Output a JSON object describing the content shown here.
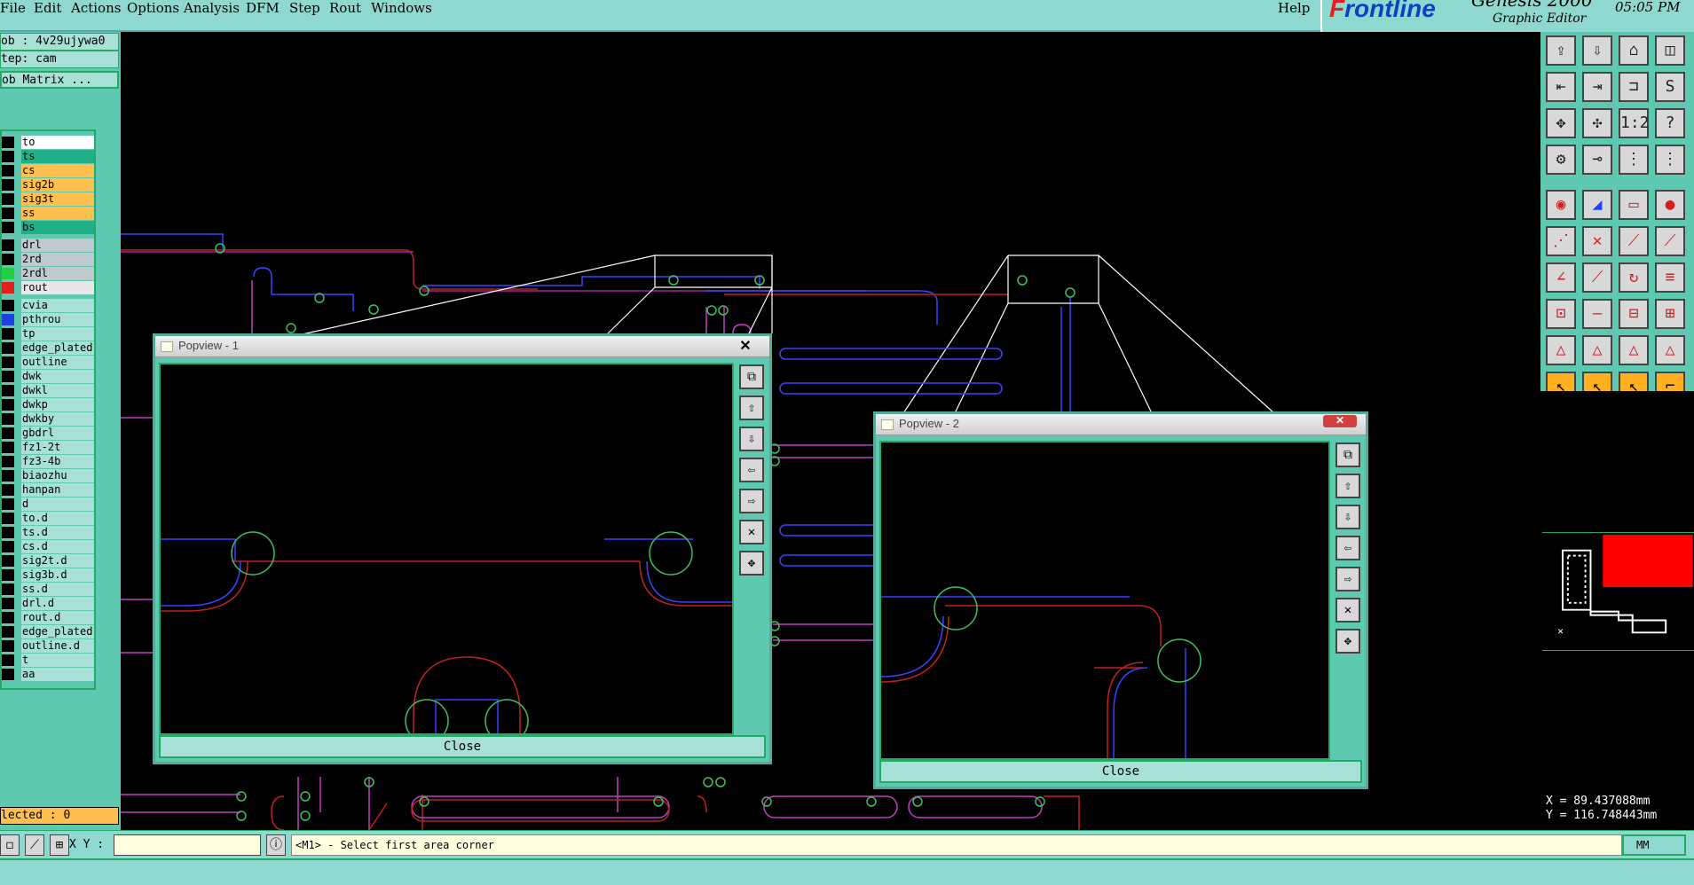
{
  "menubar": {
    "items": [
      "File",
      "Edit",
      "Actions",
      "Options",
      "Analysis",
      "DFM",
      "Step",
      "Rout",
      "Windows"
    ],
    "help": "Help",
    "brand_logo": "Frontline",
    "brand_product": "Genesis 2000",
    "brand_subtitle": "Graphic Editor",
    "time": "05:05 PM"
  },
  "leftpanel": {
    "job": "ob : 4v29ujywa0",
    "step": "tep: cam",
    "matrix_button": "ob Matrix ...",
    "selected": "lected : 0"
  },
  "layers": [
    {
      "name": "to",
      "color": "#ffffff"
    },
    {
      "name": "ts",
      "color": "#1fb087"
    },
    {
      "name": "cs",
      "color": "#ffc050"
    },
    {
      "name": "sig2b",
      "color": "#ffc050"
    },
    {
      "name": "sig3t",
      "color": "#ffc050"
    },
    {
      "name": "ss",
      "color": "#ffc050"
    },
    {
      "name": "bs",
      "color": "#1fb087"
    },
    {
      "name": "drl",
      "color": "#c0c8d0"
    },
    {
      "name": "2rd",
      "color": "#c0c8d0"
    },
    {
      "name": "2rdl",
      "color": "#c0c8d0"
    },
    {
      "name": "rout",
      "color": "#e8e8e8"
    },
    {
      "name": "cvia",
      "color": "#a8e0d8"
    },
    {
      "name": "pthrou",
      "color": "#a8e0d8"
    },
    {
      "name": "tp",
      "color": "#a8e0d8"
    },
    {
      "name": "edge_plated",
      "color": "#a8e0d8"
    },
    {
      "name": "outline",
      "color": "#a8e0d8"
    },
    {
      "name": "dwk",
      "color": "#a8e0d8"
    },
    {
      "name": "dwkl",
      "color": "#a8e0d8"
    },
    {
      "name": "dwkp",
      "color": "#a8e0d8"
    },
    {
      "name": "dwkby",
      "color": "#a8e0d8"
    },
    {
      "name": "gbdrl",
      "color": "#a8e0d8"
    },
    {
      "name": "fz1-2t",
      "color": "#a8e0d8"
    },
    {
      "name": "fz3-4b",
      "color": "#a8e0d8"
    },
    {
      "name": "biaozhu",
      "color": "#a8e0d8"
    },
    {
      "name": "hanpan",
      "color": "#a8e0d8"
    },
    {
      "name": "d",
      "color": "#a8e0d8"
    },
    {
      "name": "to.d",
      "color": "#a8e0d8"
    },
    {
      "name": "ts.d",
      "color": "#a8e0d8"
    },
    {
      "name": "cs.d",
      "color": "#a8e0d8"
    },
    {
      "name": "sig2t.d",
      "color": "#a8e0d8"
    },
    {
      "name": "sig3b.d",
      "color": "#a8e0d8"
    },
    {
      "name": "ss.d",
      "color": "#a8e0d8"
    },
    {
      "name": "drl.d",
      "color": "#a8e0d8"
    },
    {
      "name": "rout.d",
      "color": "#a8e0d8"
    },
    {
      "name": "edge_plated",
      "color": "#a8e0d8"
    },
    {
      "name": "outline.d",
      "color": "#a8e0d8"
    },
    {
      "name": "t",
      "color": "#a8e0d8"
    },
    {
      "name": "aa",
      "color": "#a8e0d8"
    }
  ],
  "popview1": {
    "title": "Popview - 1",
    "close_label": "Close"
  },
  "popview2": {
    "title": "Popview - 2",
    "close_label": "Close"
  },
  "coords": {
    "x": "X = 89.437088mm",
    "y": "Y = 116.748443mm"
  },
  "bottombar": {
    "xy_label": "X Y :",
    "xy_value": "",
    "prompt": "<M1> - Select first area corner",
    "unit": "MM"
  }
}
